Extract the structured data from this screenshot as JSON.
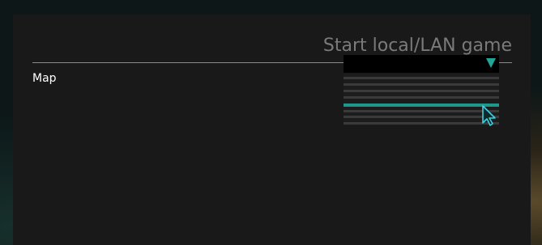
{
  "dialog": {
    "title": "Start local/LAN game"
  },
  "settings": {
    "map": {
      "label": "Map",
      "selected_value": "",
      "options_count_visible": 8,
      "highlighted_option_index": 3
    }
  },
  "colors": {
    "accent": "#1f978b",
    "panel_bg": "#191919",
    "title_text": "#7a7a7a"
  },
  "icons": {
    "dropdown": "triangle-down-icon",
    "pointer": "mouse-pointer-icon"
  }
}
